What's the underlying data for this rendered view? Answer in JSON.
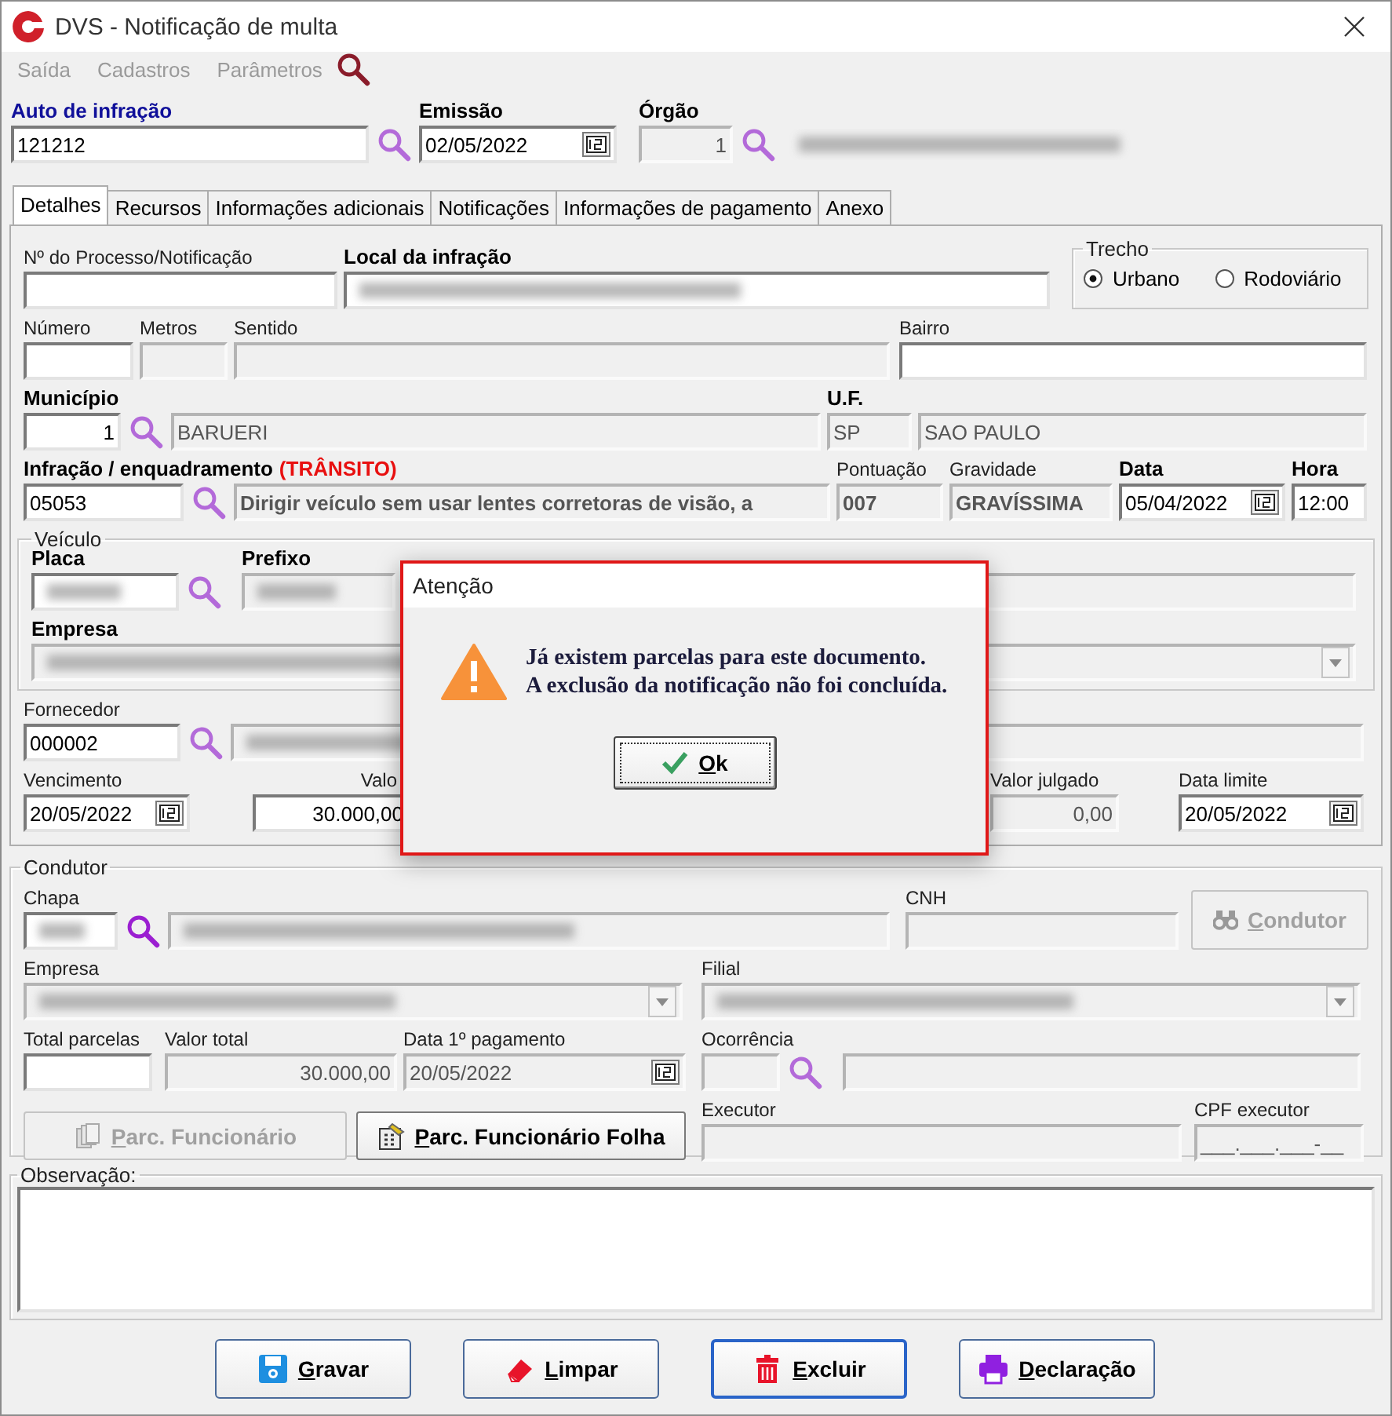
{
  "window": {
    "title": "DVS - Notificação de multa"
  },
  "menu": [
    {
      "label": "Saída",
      "disabled": true
    },
    {
      "label": "Cadastros",
      "disabled": true
    },
    {
      "label": "Parâmetros",
      "disabled": true
    }
  ],
  "header": {
    "auto": {
      "label": "Auto de infração",
      "required": true,
      "value": "121212",
      "disabled": false
    },
    "emissao": {
      "label": "Emissão",
      "required": true,
      "value": "02/05/2022",
      "disabled": false
    },
    "orgao": {
      "label": "Órgão",
      "required": true,
      "value": "1",
      "disabled": true
    },
    "orgao_nome": {
      "redacted": true,
      "disabled": true
    }
  },
  "tabs": [
    {
      "label": "Detalhes",
      "selected": true
    },
    {
      "label": "Recursos",
      "selected": false
    },
    {
      "label": "Informações adicionais",
      "selected": false
    },
    {
      "label": "Notificações",
      "selected": false
    },
    {
      "label": "Informações de pagamento",
      "selected": false
    },
    {
      "label": "Anexo",
      "selected": false
    }
  ],
  "detalhes": {
    "processo": {
      "label": "Nº do Processo/Notificação",
      "required": false,
      "disabled": false
    },
    "local": {
      "label": "Local da infração",
      "required": true,
      "redacted": true,
      "disabled": false
    },
    "trecho": {
      "label": "Trecho",
      "options": [
        {
          "label": "Urbano",
          "selected": true
        },
        {
          "label": "Rodoviário",
          "selected": false
        }
      ]
    },
    "numero": {
      "label": "Número",
      "required": false,
      "disabled": false
    },
    "metros": {
      "label": "Metros",
      "required": false,
      "disabled": true
    },
    "sentido": {
      "label": "Sentido",
      "required": false,
      "disabled": true
    },
    "bairro": {
      "label": "Bairro",
      "required": false,
      "disabled": false
    },
    "municipio": {
      "label": "Município",
      "required": true,
      "value": "1",
      "disabled": false
    },
    "municipio_nome": {
      "value": "BARUERI",
      "disabled": true
    },
    "uf": {
      "label": "U.F.",
      "required": true,
      "value": "SP",
      "disabled": true
    },
    "uf_nome": {
      "value": "SAO PAULO",
      "disabled": true
    },
    "infracao": {
      "label": "Infração / enquadramento",
      "tag": "(TRÂNSITO)",
      "required": true,
      "value": "05053",
      "disabled": false
    },
    "infracao_desc": {
      "value": "Dirigir veículo sem usar lentes corretoras de visão, a",
      "disabled": true
    },
    "pontuacao": {
      "label": "Pontuação",
      "required": false,
      "value": "007",
      "disabled": true
    },
    "gravidade": {
      "label": "Gravidade",
      "required": false,
      "value": "GRAVÍSSIMA",
      "disabled": true
    },
    "data": {
      "label": "Data",
      "required": true,
      "value": "05/04/2022",
      "disabled": false
    },
    "hora": {
      "label": "Hora",
      "required": true,
      "value": "12:00",
      "disabled": false
    },
    "veiculo": {
      "title": "Veículo",
      "placa": {
        "label": "Placa",
        "required": true,
        "redacted": true,
        "disabled": false
      },
      "prefixo": {
        "label": "Prefixo",
        "required": true,
        "redacted": true,
        "disabled": true
      },
      "condicao": {
        "disabled": true
      },
      "empresa": {
        "label": "Empresa",
        "required": true,
        "redacted": true,
        "disabled": true
      }
    },
    "fornecedor": {
      "label": "Fornecedor",
      "required": false,
      "value": "000002",
      "disabled": false
    },
    "fornecedor_nome": {
      "redacted": true,
      "disabled": true
    },
    "vencimento": {
      "label": "Vencimento",
      "required": false,
      "value": "20/05/2022",
      "disabled": false
    },
    "valor": {
      "label": "Valo",
      "required": false,
      "value": "30.000,00",
      "disabled": false
    },
    "valor_julgado": {
      "label": "Valor julgado",
      "required": false,
      "value": "0,00",
      "disabled": true
    },
    "data_limite": {
      "label": "Data limite",
      "required": false,
      "value": "20/05/2022",
      "disabled": false
    }
  },
  "condutor": {
    "title": "Condutor",
    "chapa": {
      "label": "Chapa",
      "required": false,
      "redacted": true,
      "disabled": false
    },
    "chapa_nome": {
      "redacted": true,
      "disabled": true
    },
    "cnh": {
      "label": "CNH",
      "required": false,
      "disabled": true
    },
    "condutor_button": {
      "label": "Condutor",
      "disabled": true
    },
    "empresa": {
      "label": "Empresa",
      "required": false,
      "redacted": true,
      "disabled": true
    },
    "filial": {
      "label": "Filial",
      "required": false,
      "redacted": true,
      "disabled": true
    },
    "total_parcelas": {
      "label": "Total parcelas",
      "required": false,
      "disabled": false
    },
    "valor_total": {
      "label": "Valor total",
      "required": false,
      "value": "30.000,00",
      "disabled": true
    },
    "data_pagamento": {
      "label": "Data 1º pagamento",
      "required": false,
      "value": "20/05/2022",
      "disabled": true
    },
    "ocorrencia": {
      "label": "Ocorrência",
      "required": false,
      "disabled": true
    },
    "ocorrencia_nome": {
      "disabled": true
    },
    "parc_funcionario": {
      "label": "Parc. Funcionário",
      "disabled": true
    },
    "parc_folha": {
      "label": "Parc. Funcionário Folha",
      "disabled": false
    },
    "executor": {
      "label": "Executor",
      "required": false,
      "disabled": true
    },
    "cpf_executor": {
      "label": "CPF executor",
      "required": false,
      "value": "___.___.___-__",
      "disabled": true
    }
  },
  "observacao": {
    "title": "Observação:"
  },
  "dialog": {
    "title": "Atenção",
    "lines": [
      "Já existem parcelas para este documento.",
      "A exclusão da notificação não foi concluída."
    ],
    "button": "Ok"
  },
  "buttons": [
    {
      "label": "Gravar",
      "kind": "save",
      "focused": false
    },
    {
      "label": "Limpar",
      "kind": "clear",
      "focused": false
    },
    {
      "label": "Excluir",
      "kind": "delete",
      "focused": true
    },
    {
      "label": "Declaração",
      "kind": "print",
      "focused": false
    }
  ]
}
